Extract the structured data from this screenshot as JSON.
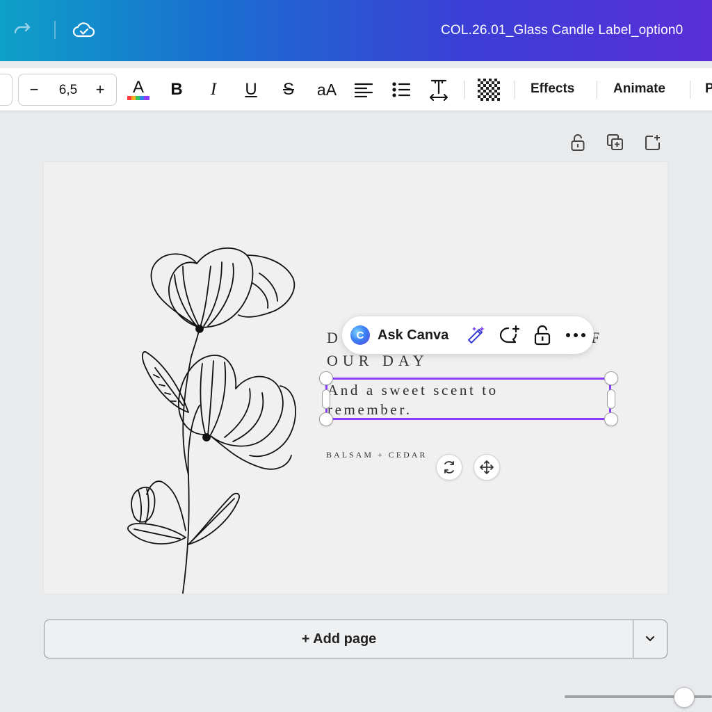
{
  "header": {
    "title": "COL.26.01_Glass Candle Label_option0",
    "icons": [
      "redo-icon",
      "cloud-saved-icon"
    ]
  },
  "toolbar": {
    "font_size": "6,5",
    "minus": "−",
    "plus": "+",
    "effects_label": "Effects",
    "animate_label": "Animate",
    "position_label": "P",
    "text_color_glyph": "A",
    "bold_glyph": "B",
    "italic_glyph": "I",
    "underline_glyph": "U",
    "strike_glyph": "S",
    "case_glyph": "aA",
    "accent_colors": [
      "#ff3b3b",
      "#ffb020",
      "#35c759",
      "#2f80ed",
      "#8b3dff"
    ]
  },
  "context_menu": {
    "ai_badge": "C",
    "ask_label": "Ask Canva",
    "icons": [
      "magic-edit-icon",
      "comment-add-icon",
      "lock-icon",
      "more-icon"
    ]
  },
  "design": {
    "line1_start": "D",
    "line1_end": "F",
    "line2": "OUR DAY",
    "body_line1": "And a sweet scent to",
    "body_line2": "remember.",
    "scent": "BALSAM + CEDAR"
  },
  "footer": {
    "add_page_label": "+ Add page"
  },
  "colors": {
    "selection": "#8b3dff",
    "header_gradient_start": "#0ea0c8",
    "header_gradient_end": "#5a2fd8"
  }
}
